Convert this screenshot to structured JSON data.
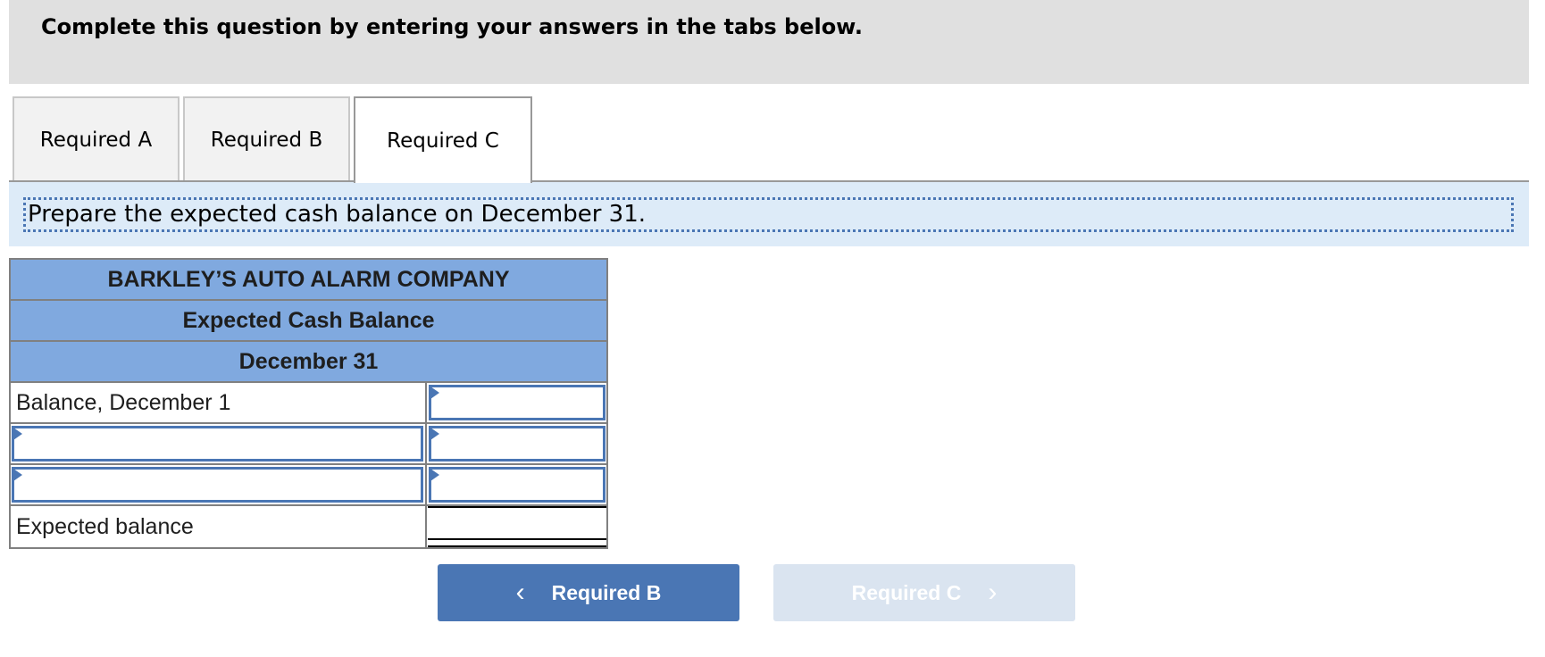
{
  "header": {
    "instruction": "Complete this question by entering your answers in the tabs below."
  },
  "tabs": [
    {
      "label": "Required A",
      "active": false
    },
    {
      "label": "Required B",
      "active": false
    },
    {
      "label": "Required C",
      "active": true
    }
  ],
  "prompt": "Prepare the expected cash balance on December 31.",
  "statement": {
    "company": "BARKLEY’S AUTO ALARM COMPANY",
    "title": "Expected Cash Balance",
    "date": "December 31",
    "rows": [
      {
        "label": "Balance, December 1",
        "label_editable": false,
        "value": ""
      },
      {
        "label": "",
        "label_editable": true,
        "value": ""
      },
      {
        "label": "",
        "label_editable": true,
        "value": ""
      },
      {
        "label": "Expected balance",
        "label_editable": false,
        "value": "",
        "is_total": true
      }
    ]
  },
  "nav": {
    "prev_label": "Required B",
    "next_label": "Required C",
    "prev_icon": "chevron-left-icon",
    "next_icon": "chevron-right-icon",
    "next_disabled": true
  },
  "colors": {
    "accent": "#4a76b4",
    "table_header": "#80a9df",
    "prompt_band": "#ddebf8",
    "disabled_button": "#dae4f0"
  }
}
